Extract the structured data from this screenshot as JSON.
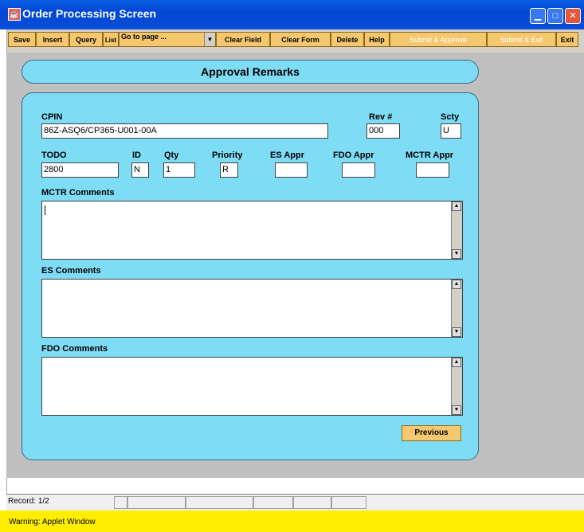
{
  "window": {
    "title": "Order Processing Screen"
  },
  "toolbar": {
    "save": "Save",
    "insert": "Insert",
    "query": "Query",
    "list": "List",
    "goto": "Go to page ...",
    "clear_field": "Clear Field",
    "clear_form": "Clear Form",
    "delete": "Delete",
    "help": "Help",
    "submit_approve": "Submit & Approve",
    "submit_exit": "Submit & Exit",
    "exit": "Exit"
  },
  "header": {
    "title": "Approval Remarks"
  },
  "form": {
    "cpin_label": "CPIN",
    "cpin_value": "86Z-ASQ6/CP365-U001-00A",
    "rev_label": "Rev #",
    "rev_value": "000",
    "scty_label": "Scty",
    "scty_value": "U",
    "todo_label": "TODO",
    "todo_value": "2800",
    "id_label": "ID",
    "id_value": "N",
    "qty_label": "Qty",
    "qty_value": "1",
    "priority_label": "Priority",
    "priority_value": "R",
    "es_appr_label": "ES Appr",
    "es_appr_value": "",
    "fdo_appr_label": "FDO Appr",
    "fdo_appr_value": "",
    "mctr_appr_label": "MCTR Appr",
    "mctr_appr_value": "",
    "mctr_comments_label": "MCTR Comments",
    "es_comments_label": "ES Comments",
    "fdo_comments_label": "FDO Comments",
    "previous": "Previous"
  },
  "status": {
    "record": "Record: 1/2"
  },
  "warning": {
    "text": "Warning: Applet Window"
  },
  "colors": {
    "panel": "#7fdcf5",
    "button": "#f5c870",
    "titlebar": "#0046d5",
    "warning": "#ffee00"
  }
}
